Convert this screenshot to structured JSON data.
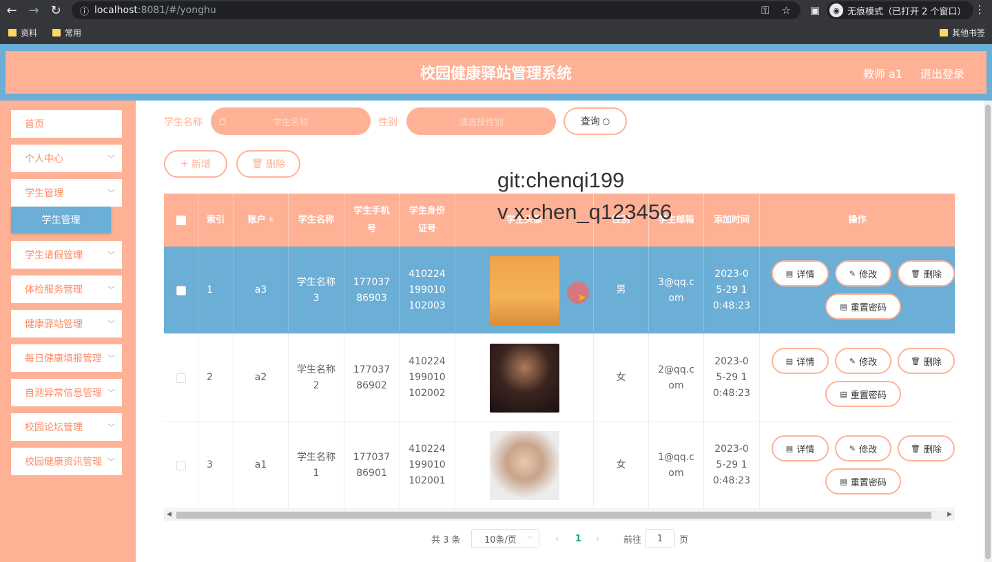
{
  "browser": {
    "url_host": "localhost",
    "url_path": ":8081/#/yonghu",
    "incognito_label": "无痕模式（已打开 2 个窗口）",
    "bookmarks": [
      "资料",
      "常用"
    ],
    "other_bookmarks": "其他书签"
  },
  "header": {
    "title": "校园健康驿站管理系统",
    "user": "教师 a1",
    "logout": "退出登录"
  },
  "sidebar": {
    "items": [
      {
        "label": "首页"
      },
      {
        "label": "个人中心"
      },
      {
        "label": "学生管理"
      },
      {
        "label": "学生请假管理"
      },
      {
        "label": "体检服务管理"
      },
      {
        "label": "健康驿站管理"
      },
      {
        "label": "每日健康填报管理"
      },
      {
        "label": "自测异常信息管理"
      },
      {
        "label": "校园论坛管理"
      },
      {
        "label": "校园健康资讯管理"
      }
    ],
    "active_sub": "学生管理"
  },
  "search": {
    "name_label": "学生名称",
    "name_placeholder": "学生名称",
    "gender_label": "性别",
    "gender_placeholder": "请选择性别",
    "query_button": "查询"
  },
  "actions": {
    "add": "新增",
    "delete": "删除"
  },
  "watermark": {
    "line1": "git:chenqi199",
    "line2": "v x:chen_q123456"
  },
  "table": {
    "columns": [
      "索引",
      "账户",
      "学生名称",
      "学生手机号",
      "学生身份证号",
      "学生头像",
      "性别",
      "学生邮箱",
      "添加时间",
      "操作"
    ],
    "rows": [
      {
        "index": "1",
        "account": "a3",
        "name": "学生名称3",
        "phone": "17703786903",
        "id_card": "410224199010102003",
        "gender": "男",
        "email": "3@qq.com",
        "time": "2023-05-29 10:48:23"
      },
      {
        "index": "2",
        "account": "a2",
        "name": "学生名称2",
        "phone": "17703786902",
        "id_card": "410224199010102002",
        "gender": "女",
        "email": "2@qq.com",
        "time": "2023-05-29 10:48:23"
      },
      {
        "index": "3",
        "account": "a1",
        "name": "学生名称1",
        "phone": "17703786901",
        "id_card": "410224199010102001",
        "gender": "女",
        "email": "1@qq.com",
        "time": "2023-05-29 10:48:23"
      }
    ],
    "ops": {
      "detail": "详情",
      "edit": "修改",
      "delete": "删除",
      "reset": "重置密码"
    }
  },
  "pager": {
    "total": "共 3 条",
    "page_size": "10条/页",
    "current": "1",
    "goto_label": "前往",
    "goto_value": "1",
    "page_unit": "页"
  },
  "colors": {
    "accent": "#ffb196",
    "header_bg": "#6baed6",
    "selected_row": "#6baed6"
  }
}
